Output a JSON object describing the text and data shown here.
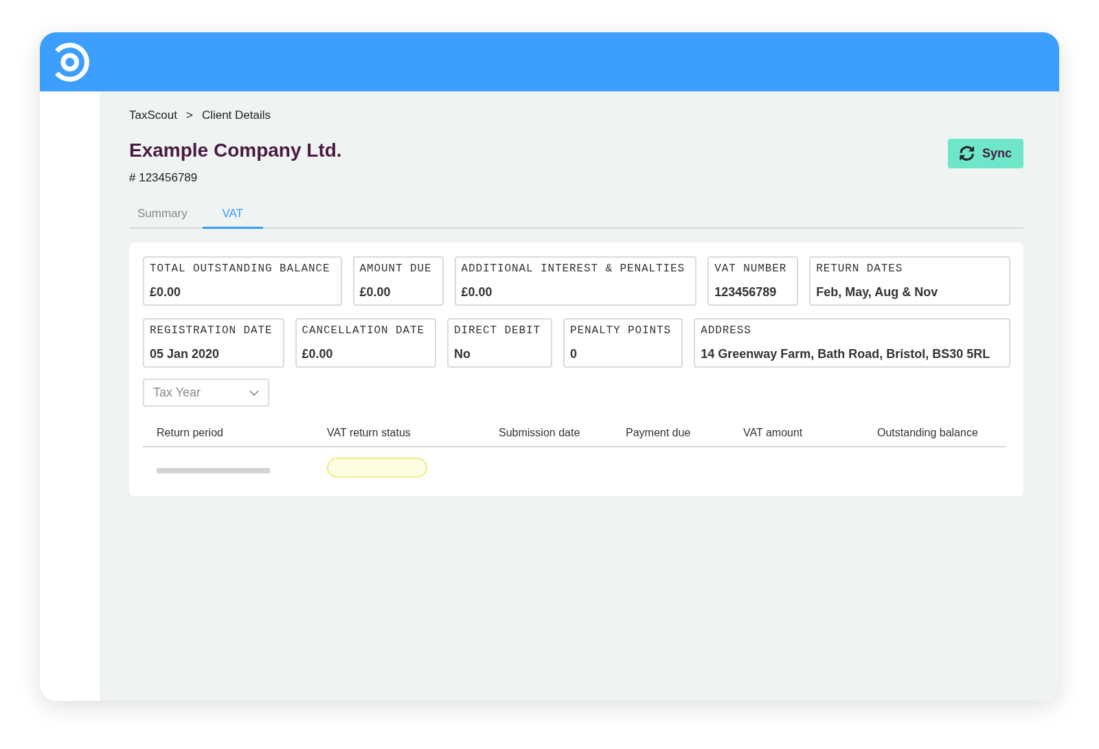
{
  "breadcrumb": {
    "items": [
      "TaxScout",
      "Client Details"
    ],
    "separator": ">"
  },
  "company": {
    "name": "Example Company Ltd.",
    "number": "# 123456789"
  },
  "sync_button": {
    "label": "Sync"
  },
  "tabs": [
    {
      "label": "Summary",
      "selected": false
    },
    {
      "label": "VAT",
      "selected": true
    }
  ],
  "info_rows": [
    [
      {
        "label": "TOTAL OUTSTANDING BALANCE",
        "value": "£0.00"
      },
      {
        "label": "AMOUNT DUE",
        "value": "£0.00"
      },
      {
        "label": "ADDITIONAL INTEREST & PENALTIES",
        "value": "£0.00"
      },
      {
        "label": "VAT NUMBER",
        "value": "123456789"
      },
      {
        "label": "RETURN DATES",
        "value": "Feb, May, Aug & Nov"
      }
    ],
    [
      {
        "label": "REGISTRATION DATE",
        "value": "05 Jan 2020"
      },
      {
        "label": "CANCELLATION DATE",
        "value": "£0.00"
      },
      {
        "label": "DIRECT DEBIT",
        "value": "No"
      },
      {
        "label": "PENALTY POINTS",
        "value": "0"
      },
      {
        "label": "ADDRESS",
        "value": "14 Greenway Farm, Bath Road, Bristol, BS30 5RL"
      }
    ]
  ],
  "tax_year_select": {
    "placeholder": "Tax Year"
  },
  "table": {
    "columns": [
      "Return period",
      "VAT return status",
      "Submission date",
      "Payment due",
      "VAT amount",
      "Outstanding balance"
    ],
    "loading": true
  }
}
